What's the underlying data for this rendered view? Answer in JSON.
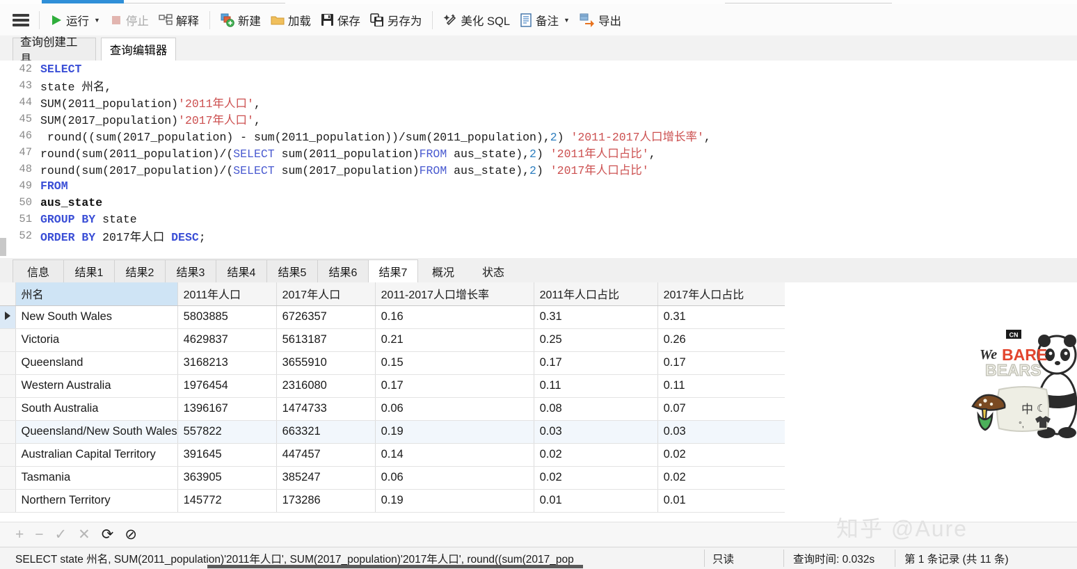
{
  "toolbar": {
    "menu_icon": "hamburger-icon",
    "items": [
      {
        "label": "运行",
        "icon": "play-icon",
        "disabled": false,
        "caret": true
      },
      {
        "label": "停止",
        "icon": "stop-icon",
        "disabled": true,
        "caret": false
      },
      {
        "label": "解释",
        "icon": "explain-icon",
        "disabled": false,
        "caret": false
      },
      {
        "label": "新建",
        "icon": "new-query-icon",
        "disabled": false,
        "caret": false
      },
      {
        "label": "加载",
        "icon": "folder-icon",
        "disabled": false,
        "caret": false
      },
      {
        "label": "保存",
        "icon": "save-icon",
        "disabled": false,
        "caret": false
      },
      {
        "label": "另存为",
        "icon": "save-as-icon",
        "disabled": false,
        "caret": false
      },
      {
        "label": "美化 SQL",
        "icon": "beautify-icon",
        "disabled": false,
        "caret": false
      },
      {
        "label": "备注",
        "icon": "note-icon",
        "disabled": false,
        "caret": true
      },
      {
        "label": "导出",
        "icon": "export-icon",
        "disabled": false,
        "caret": false
      }
    ]
  },
  "editor_tabs": [
    {
      "label": "查询创建工具",
      "active": false
    },
    {
      "label": "查询编辑器",
      "active": true
    }
  ],
  "sql": {
    "lines": [
      {
        "no": "42",
        "html": "<span class=\"kw\">SELECT</span>"
      },
      {
        "no": "43",
        "html": "<span class=\"code-txt\">state 州名,</span>"
      },
      {
        "no": "44",
        "html": "<span class=\"code-txt\">SUM(2011_population)</span><span class=\"str\">'2011年人口'</span><span class=\"code-txt\">,</span>"
      },
      {
        "no": "45",
        "html": "<span class=\"code-txt\">SUM(2017_population)</span><span class=\"str\">'2017年人口'</span><span class=\"code-txt\">,</span>"
      },
      {
        "no": "46",
        "html": "<span class=\"code-txt\"> round((sum(2017_population) - sum(2011_population))/sum(2011_population),</span><span class=\"num\">2</span><span class=\"code-txt\">) </span><span class=\"str\">'2011-2017人口增长率'</span><span class=\"code-txt\">,</span>"
      },
      {
        "no": "47",
        "html": "<span class=\"code-txt\">round(sum(2011_population)/(</span><span class=\"kw2\">SELECT</span><span class=\"code-txt\"> sum(2011_population)</span><span class=\"kw2\">FROM</span><span class=\"code-txt\"> aus_state),</span><span class=\"num\">2</span><span class=\"code-txt\">) </span><span class=\"str\">'2011年人口占比'</span><span class=\"code-txt\">,</span>"
      },
      {
        "no": "48",
        "html": "<span class=\"code-txt\">round(sum(2017_population)/(</span><span class=\"kw2\">SELECT</span><span class=\"code-txt\"> sum(2017_population)</span><span class=\"kw2\">FROM</span><span class=\"code-txt\"> aus_state),</span><span class=\"num\">2</span><span class=\"code-txt\">) </span><span class=\"str\">'2017年人口占比'</span>"
      },
      {
        "no": "49",
        "html": "<span class=\"kw\">FROM</span>"
      },
      {
        "no": "50",
        "html": "<span class=\"idt\">aus_state</span>"
      },
      {
        "no": "51",
        "html": "<span class=\"kw\">GROUP BY</span><span class=\"code-txt\"> state</span>"
      },
      {
        "no": "52",
        "html": "<span class=\"kw\">ORDER BY</span><span class=\"code-txt\"> 2017年人口 </span><span class=\"kw\">DESC</span><span class=\"code-txt\">;</span>"
      }
    ]
  },
  "result_tabs": [
    {
      "label": "信息",
      "active": false,
      "plain": false
    },
    {
      "label": "结果1",
      "active": false,
      "plain": false
    },
    {
      "label": "结果2",
      "active": false,
      "plain": false
    },
    {
      "label": "结果3",
      "active": false,
      "plain": false
    },
    {
      "label": "结果4",
      "active": false,
      "plain": false
    },
    {
      "label": "结果5",
      "active": false,
      "plain": false
    },
    {
      "label": "结果6",
      "active": false,
      "plain": false
    },
    {
      "label": "结果7",
      "active": true,
      "plain": false
    },
    {
      "label": "概况",
      "active": false,
      "plain": true
    },
    {
      "label": "状态",
      "active": false,
      "plain": true
    }
  ],
  "grid": {
    "columns": [
      "州名",
      "2011年人口",
      "2017年人口",
      "2011-2017人口增长率",
      "2011年人口占比",
      "2017年人口占比"
    ],
    "selected_column": "州名",
    "rows": [
      {
        "cells": [
          "New South Wales",
          "5803885",
          "6726357",
          "0.16",
          "0.31",
          "0.31"
        ],
        "current": true,
        "highlight": false
      },
      {
        "cells": [
          "Victoria",
          "4629837",
          "5613187",
          "0.21",
          "0.25",
          "0.26"
        ],
        "current": false,
        "highlight": false
      },
      {
        "cells": [
          "Queensland",
          "3168213",
          "3655910",
          "0.15",
          "0.17",
          "0.17"
        ],
        "current": false,
        "highlight": false
      },
      {
        "cells": [
          "Western Australia",
          "1976454",
          "2316080",
          "0.17",
          "0.11",
          "0.11"
        ],
        "current": false,
        "highlight": false
      },
      {
        "cells": [
          "South Australia",
          "1396167",
          "1474733",
          "0.06",
          "0.08",
          "0.07"
        ],
        "current": false,
        "highlight": false
      },
      {
        "cells": [
          "Queensland/New South Wales",
          "557822",
          "663321",
          "0.19",
          "0.03",
          "0.03"
        ],
        "current": false,
        "highlight": true
      },
      {
        "cells": [
          "Australian Capital Territory",
          "391645",
          "447457",
          "0.14",
          "0.02",
          "0.02"
        ],
        "current": false,
        "highlight": false
      },
      {
        "cells": [
          "Tasmania",
          "363905",
          "385247",
          "0.06",
          "0.02",
          "0.02"
        ],
        "current": false,
        "highlight": false
      },
      {
        "cells": [
          "Northern Territory",
          "145772",
          "173286",
          "0.19",
          "0.01",
          "0.01"
        ],
        "current": false,
        "highlight": false
      }
    ]
  },
  "nav_toolbar": {
    "buttons": [
      {
        "glyph": "+",
        "name": "add-record-button",
        "enabled": false
      },
      {
        "glyph": "−",
        "name": "delete-record-button",
        "enabled": false
      },
      {
        "glyph": "✓",
        "name": "apply-change-button",
        "enabled": false
      },
      {
        "glyph": "✕",
        "name": "cancel-change-button",
        "enabled": false
      },
      {
        "glyph": "⟳",
        "name": "refresh-button",
        "enabled": true
      },
      {
        "glyph": "⊘",
        "name": "stop-loading-button",
        "enabled": true
      }
    ]
  },
  "status_bar": {
    "sql_preview": "SELECT state 州名, SUM(2011_population)'2011年人口', SUM(2017_population)'2017年人口',  round((sum(2017_pop",
    "readonly": "只读",
    "query_time": "查询时间: 0.032s",
    "records": "第 1 条记录 (共 11 条)"
  },
  "watermark": {
    "text": "知乎 @Aure"
  },
  "sticker": {
    "brand": "CN",
    "title_we": "We",
    "title_bare": "BARE",
    "title_bears": "BEARS"
  }
}
